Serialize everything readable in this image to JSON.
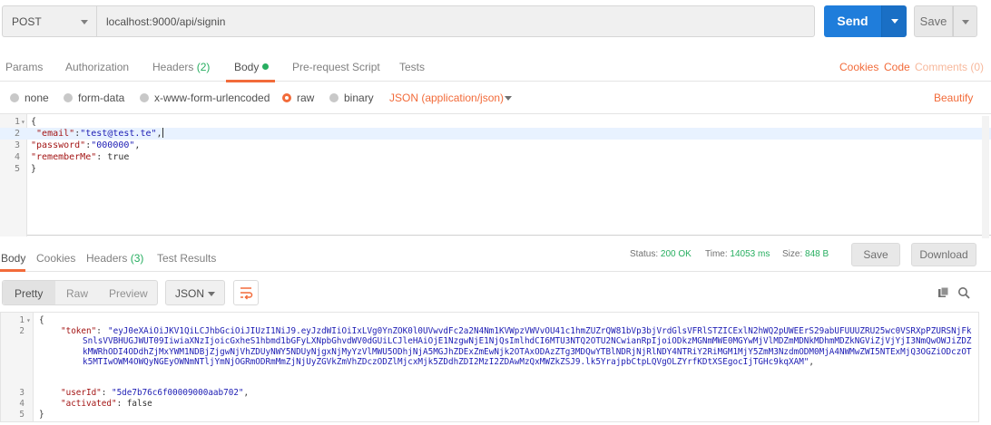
{
  "request": {
    "method": "POST",
    "url": "localhost:9000/api/signin",
    "send_label": "Send",
    "save_label": "Save"
  },
  "request_tabs": {
    "params": "Params",
    "authorization": "Authorization",
    "headers": "Headers",
    "headers_count": "(2)",
    "body": "Body",
    "pre_request_script": "Pre-request Script",
    "tests": "Tests",
    "cookies": "Cookies",
    "code": "Code",
    "comments": "Comments (0)"
  },
  "body_options": {
    "none": "none",
    "form_data": "form-data",
    "urlencoded": "x-www-form-urlencoded",
    "raw": "raw",
    "binary": "binary",
    "content_type": "JSON (application/json)",
    "beautify": "Beautify",
    "selected": "raw"
  },
  "request_body": {
    "line_numbers": [
      "1",
      "2",
      "3",
      "4",
      "5"
    ],
    "line1": "{",
    "email_key": "\"email\"",
    "email_value": "\"test@test.te\"",
    "password_key": "\"password\"",
    "password_value": "\"000000\"",
    "remember_key": "\"rememberMe\"",
    "remember_value": "true",
    "line5": "}"
  },
  "response_tabs": {
    "body": "Body",
    "cookies": "Cookies",
    "headers": "Headers",
    "headers_count": "(3)",
    "test_results": "Test Results"
  },
  "response_meta": {
    "status_label": "Status:",
    "status_value": "200 OK",
    "time_label": "Time:",
    "time_value": "14053 ms",
    "size_label": "Size:",
    "size_value": "848 B",
    "save_label": "Save",
    "download_label": "Download"
  },
  "response_toolbar": {
    "pretty": "Pretty",
    "raw": "Raw",
    "preview": "Preview",
    "format": "JSON"
  },
  "response_body": {
    "line_numbers": [
      "1",
      "2",
      "3",
      "4",
      "5"
    ],
    "line1": "{",
    "token_key": "\"token\"",
    "token_value": "\"eyJ0eXAiOiJKV1QiLCJhbGciOiJIUzI1NiJ9.eyJzdWIiOiIxLVg0YnZOK0l0UVwvdFc2a2N4Nm1KVWpzVWVvOU41c1hmZUZrQW81bVp3bjVrdGlsVFRlSTZICExlN2hWQ2pUWEErS29abUFUUUZRU25wc0VSRXpPZURSNjFkSnlsVVBHUGJWUT09IiwiaXNzIjoicGxheS1hbmd1bGFyLXNpbGhvdWV0dGUiLCJleHAiOjE1NzgwNjE1NjQsImlhdCI6MTU3NTQ2OTU2NCwianRpIjoiODkzMGNmMWE0MGYwMjVlMDZmMDNkMDhmMDZkNGViZjVjYjI3NmQwOWJiZDZkMWRhODI4ODdhZjMxYWM1NDBjZjgwNjVhZDUyNWY5NDUyNjgxNjMyYzVlMWU5ODhjNjA5MGJhZDExZmEwNjk2OTAxODAzZTg3MDQwYTBlNDRjNjRlNDY4NTRiY2RiMGM1MjY5ZmM3NzdmODM0MjA4NWMwZWI5NTExMjQ3OGZiODczOTk5MTIwOWM4OWQyNGEyOWNmNTljYmNjOGRmODRmMmZjNjUyZGVkZmVhZDczODZlMjcxMjk5ZDdhZDI2MzI2ZDAwMzQxMWZkZSJ9.lk5YrajpbCtpLQVgOLZYrfKDtXSEgocIjTGHc9kqXAM\"",
    "user_id_key": "\"userId\"",
    "user_id_value": "\"5de7b76c6f00009000aab702\"",
    "activated_key": "\"activated\"",
    "activated_value": "false",
    "line5": "}"
  },
  "icons": {
    "method_caret": "chevron-down-icon",
    "send_caret": "chevron-down-icon",
    "wrap": "wrap-lines-icon",
    "copy": "copy-icon",
    "search": "search-icon"
  },
  "colors": {
    "send": "#1f7ddb",
    "accent": "#f26b3a",
    "ok": "#27ae60",
    "string": "#1c1cb4",
    "key": "#a31515"
  }
}
